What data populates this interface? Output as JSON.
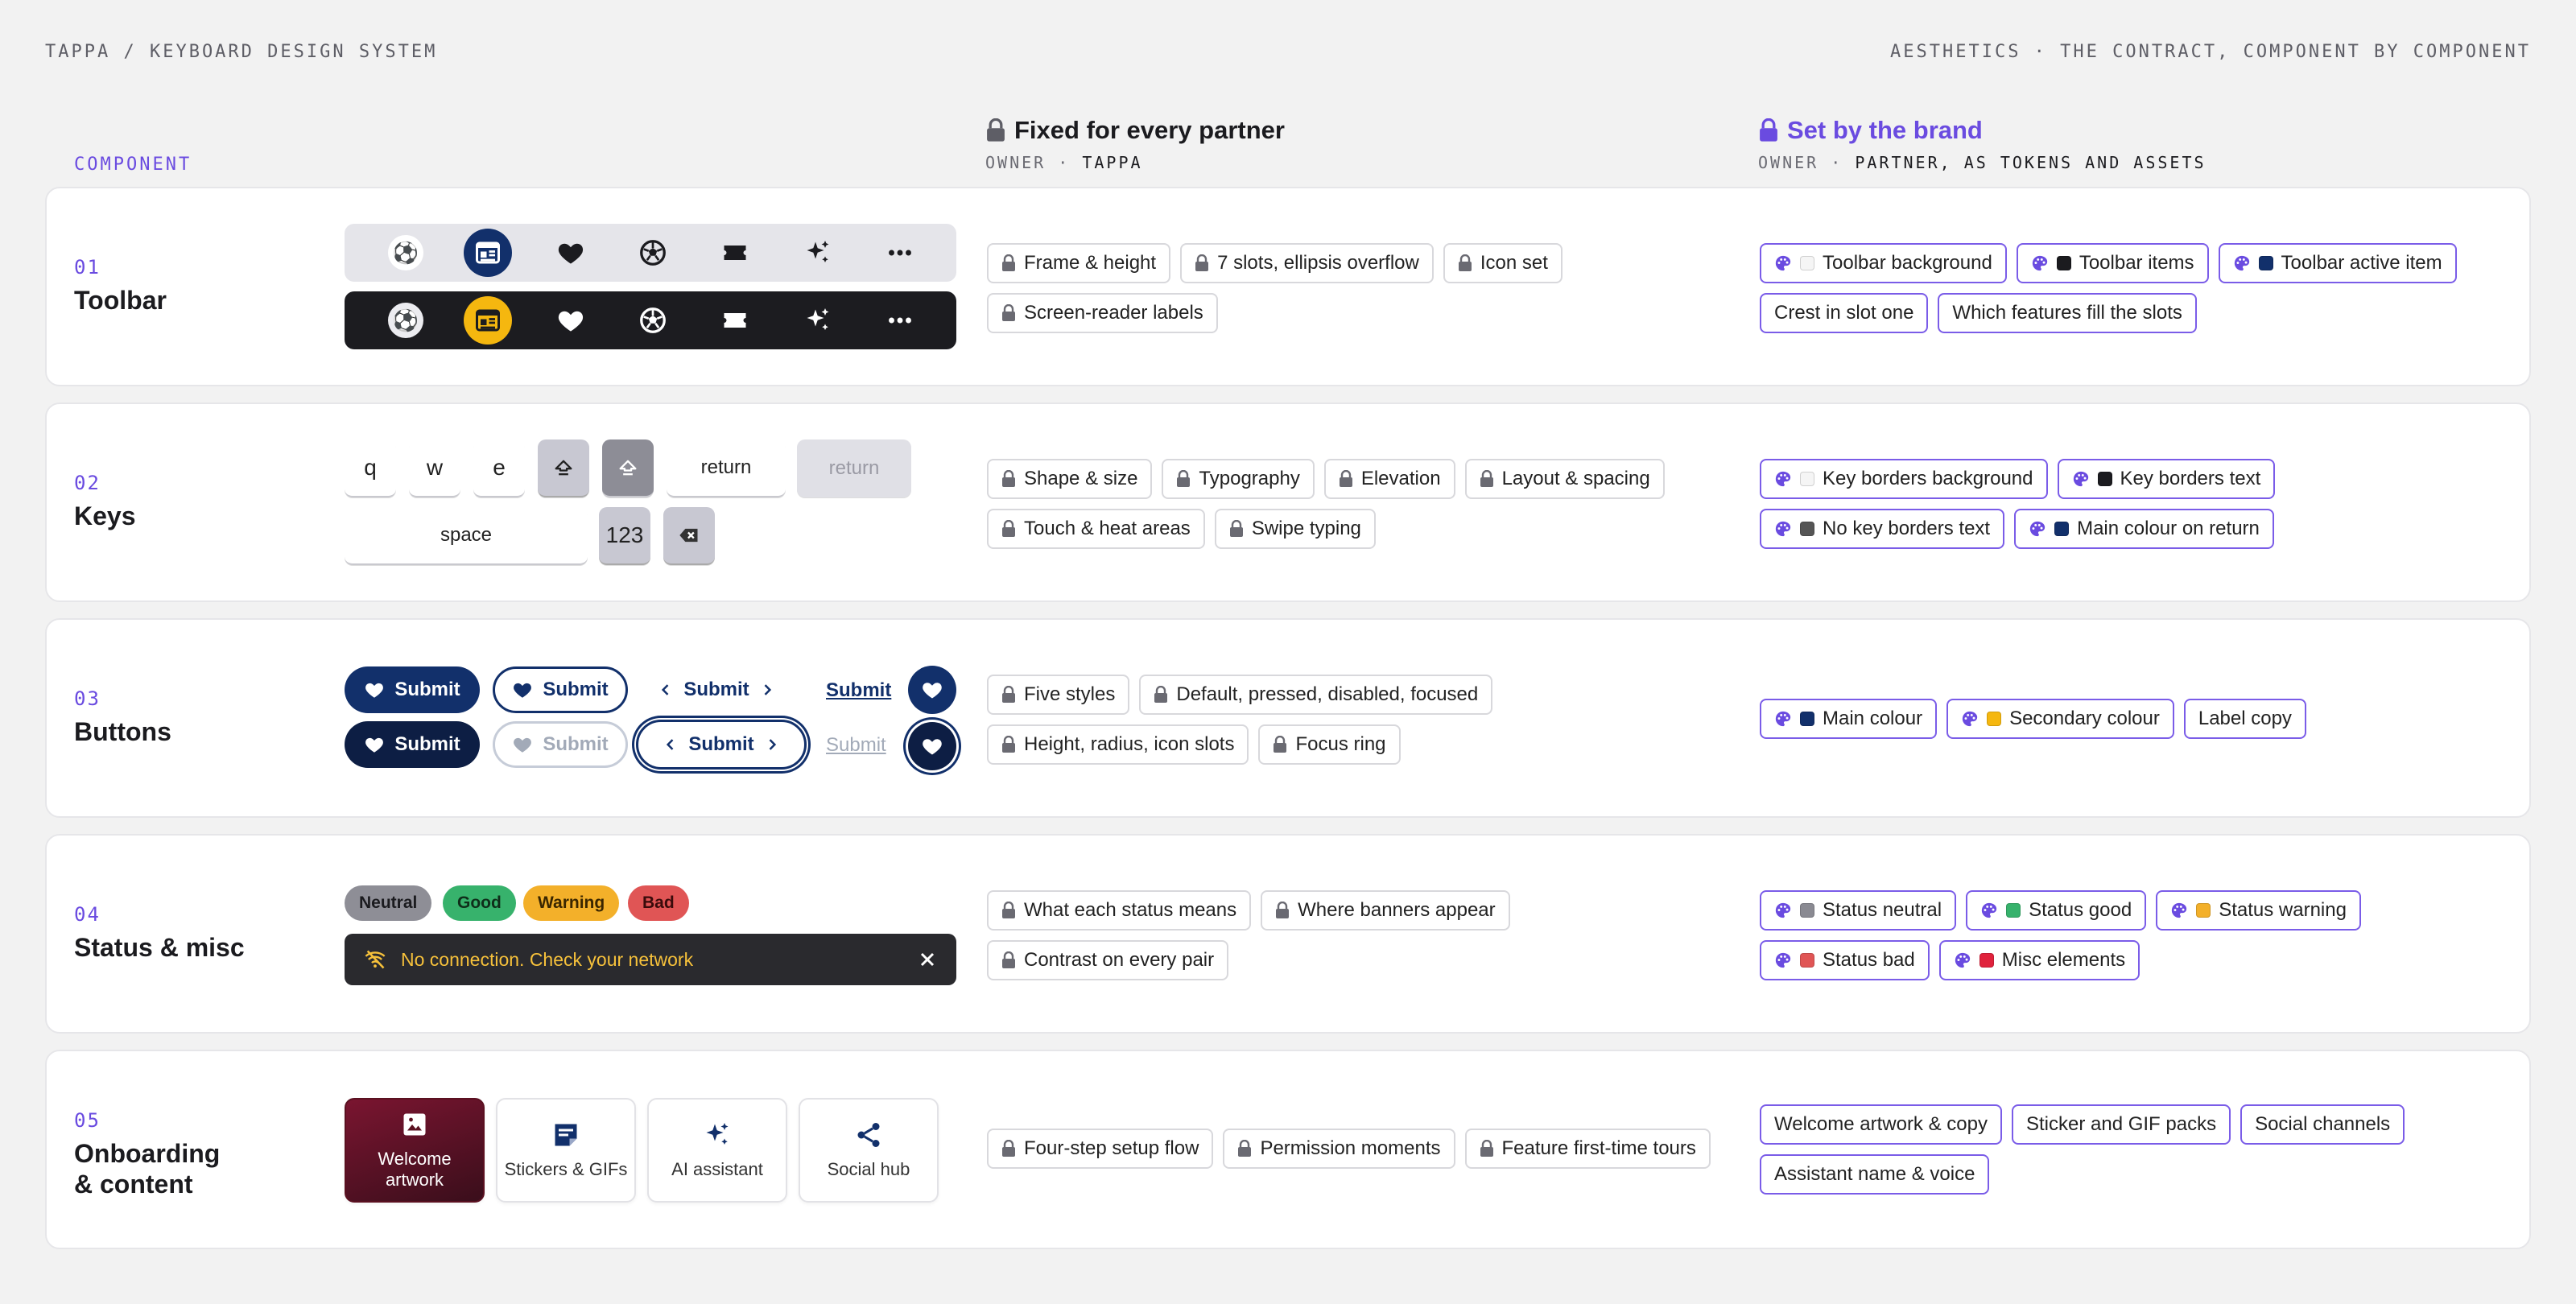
{
  "header": {
    "left": "TAPPA / KEYBOARD DESIGN SYSTEM",
    "right": "AESTHETICS · THE CONTRACT, COMPONENT BY COMPONENT"
  },
  "columns": {
    "component": "COMPONENT",
    "fixed_title": "Fixed for every partner",
    "fixed_owner_label": "OWNER ·",
    "fixed_owner": "TAPPA",
    "brand_title": "Set by the brand",
    "brand_owner_label": "OWNER ·",
    "brand_owner": "PARTNER, AS TOKENS AND ASSETS"
  },
  "rows": [
    {
      "num": "01",
      "name": "Toolbar",
      "fixed": [
        "Frame & height",
        "7 slots, ellipsis overflow",
        "Icon set",
        "Screen-reader labels"
      ],
      "brand": [
        {
          "label": "Toolbar background",
          "swatch": "#f5f5f5",
          "token": true
        },
        {
          "label": "Toolbar items",
          "swatch": "#1b1b1f",
          "token": true
        },
        {
          "label": "Toolbar active item",
          "swatch": "#12306b",
          "token": true
        },
        {
          "label": "Crest in slot one",
          "token": false
        },
        {
          "label": "Which features fill the slots",
          "token": false
        }
      ]
    },
    {
      "num": "02",
      "name": "Keys",
      "fixed": [
        "Shape & size",
        "Typography",
        "Elevation",
        "Layout & spacing",
        "Touch & heat areas",
        "Swipe typing"
      ],
      "brand": [
        {
          "label": "Key borders background",
          "swatch": "#f5f5f5",
          "token": true
        },
        {
          "label": "Key borders text",
          "swatch": "#1b1b1f",
          "token": true
        },
        {
          "label": "No key borders text",
          "swatch": "#555555",
          "token": true
        },
        {
          "label": "Main colour on return",
          "swatch": "#12306b",
          "token": true
        }
      ]
    },
    {
      "num": "03",
      "name": "Buttons",
      "fixed": [
        "Five styles",
        "Default, pressed, disabled, focused",
        "Height, radius, icon slots",
        "Focus ring"
      ],
      "brand": [
        {
          "label": "Main colour",
          "swatch": "#12306b",
          "token": true
        },
        {
          "label": "Secondary colour",
          "swatch": "#f5b70f",
          "token": true
        },
        {
          "label": "Label copy",
          "token": false
        }
      ]
    },
    {
      "num": "04",
      "name": "Status & misc",
      "fixed": [
        "What each status means",
        "Where banners appear",
        "Contrast on every pair"
      ],
      "brand": [
        {
          "label": "Status neutral",
          "swatch": "#8a8a92",
          "token": true
        },
        {
          "label": "Status good",
          "swatch": "#37b26c",
          "token": true
        },
        {
          "label": "Status warning",
          "swatch": "#f3b02a",
          "token": true
        },
        {
          "label": "Status bad",
          "swatch": "#e05555",
          "token": true
        },
        {
          "label": "Misc elements",
          "swatch": "#e0223c",
          "token": true
        }
      ]
    },
    {
      "num": "05",
      "name_line1": "Onboarding",
      "name_line2": "& content",
      "fixed": [
        "Four-step setup flow",
        "Permission moments",
        "Feature first-time tours"
      ],
      "brand": [
        {
          "label": "Welcome artwork & copy",
          "token": false
        },
        {
          "label": "Sticker and GIF packs",
          "token": false
        },
        {
          "label": "Social channels",
          "token": false
        },
        {
          "label": "Assistant name & voice",
          "token": false
        }
      ]
    }
  ],
  "demo": {
    "crest_glyph": "⚽",
    "keys": {
      "q": "q",
      "w": "w",
      "e": "e",
      "return": "return",
      "return_disabled": "return",
      "space": "space",
      "num": "123"
    },
    "buttons": {
      "submit": "Submit"
    },
    "status": {
      "neutral": "Neutral",
      "good": "Good",
      "warning": "Warning",
      "bad": "Bad",
      "banner": "No connection. Check your network"
    },
    "cards": {
      "welcome": "Welcome artwork",
      "stickers": "Stickers & GIFs",
      "ai": "AI assistant",
      "social": "Social hub"
    }
  },
  "colors": {
    "accent": "#6a4be0",
    "brand_navy": "#12306b",
    "brand_gold": "#f5b70f"
  }
}
